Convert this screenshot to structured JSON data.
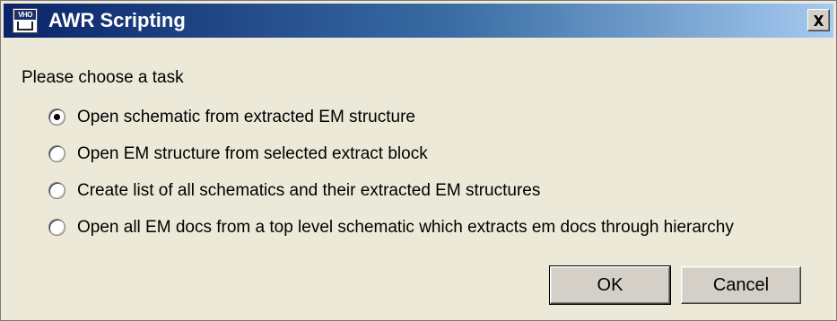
{
  "window": {
    "title": "AWR Scripting",
    "icon": "awr-app-icon",
    "icon_text": "VHO"
  },
  "titlebar": {
    "close_icon": "close-icon"
  },
  "dialog": {
    "prompt": "Please choose a task",
    "options": [
      {
        "label": "Open schematic from extracted EM structure",
        "selected": true
      },
      {
        "label": "Open EM structure from selected extract block",
        "selected": false
      },
      {
        "label": "Create list of all schematics and their extracted EM structures",
        "selected": false
      },
      {
        "label": "Open all EM docs from a top level schematic which extracts em docs through hierarchy",
        "selected": false
      }
    ],
    "buttons": {
      "ok_label": "OK",
      "cancel_label": "Cancel"
    }
  },
  "colors": {
    "titlebar_start": "#0a246a",
    "titlebar_end": "#a6caf0",
    "dialog_bg": "#ece9d8",
    "button_face": "#d4d0c8"
  }
}
